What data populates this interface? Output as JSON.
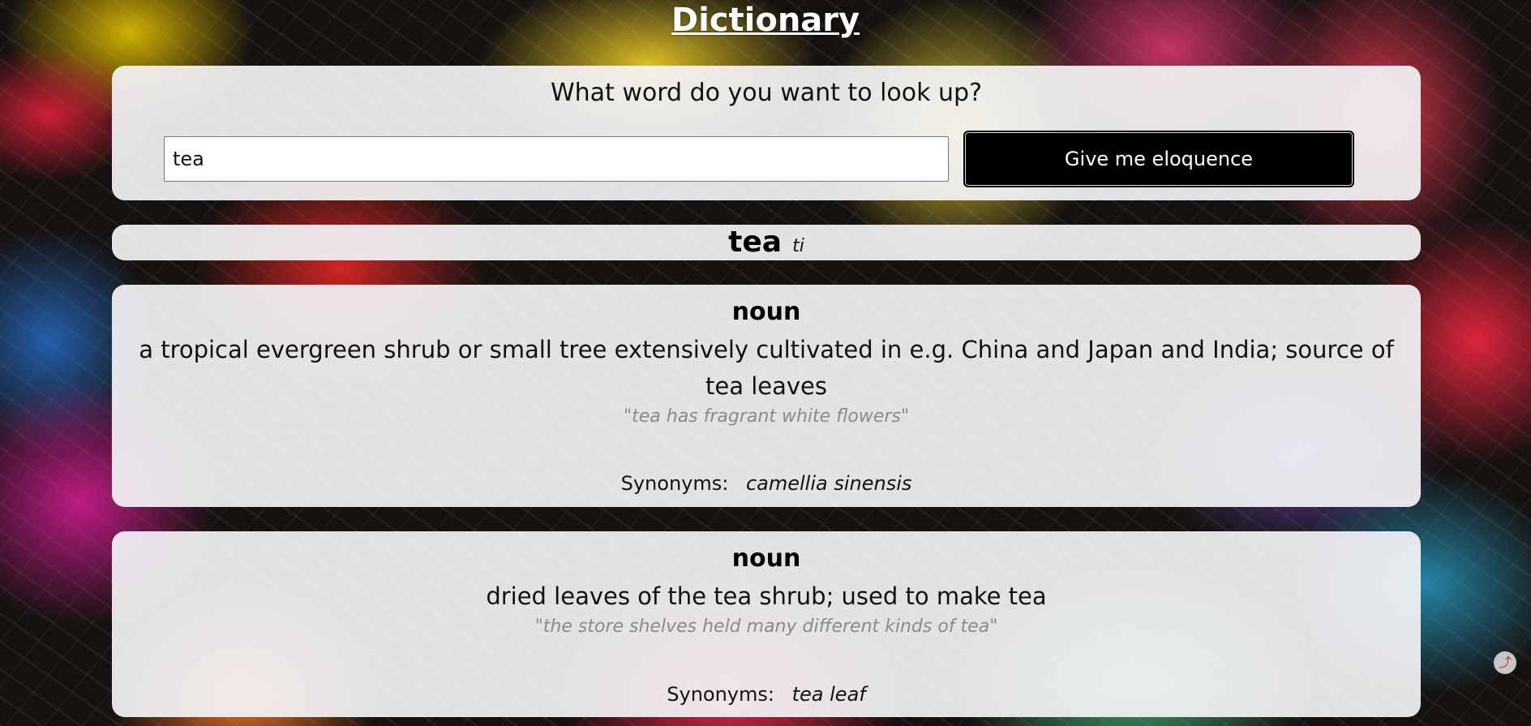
{
  "header": {
    "title": "Dictionary"
  },
  "search": {
    "prompt": "What word do you want to look up?",
    "value": "tea",
    "button_label": "Give me eloquence"
  },
  "result": {
    "word": "tea",
    "phonetic": "ti",
    "meanings": [
      {
        "part_of_speech": "noun",
        "definition": "a tropical evergreen shrub or small tree extensively cultivated in e.g. China and Japan and India; source of tea leaves",
        "example": "\"tea has fragrant white flowers\"",
        "synonyms_label": "Synonyms:",
        "synonyms": "camellia sinensis"
      },
      {
        "part_of_speech": "noun",
        "definition": "dried leaves of the tea shrub; used to make tea",
        "example": "\"the store shelves held many different kinds of tea\"",
        "synonyms_label": "Synonyms:",
        "synonyms": "tea leaf"
      }
    ]
  },
  "icons": {
    "scroll": "scroll-up-icon"
  }
}
